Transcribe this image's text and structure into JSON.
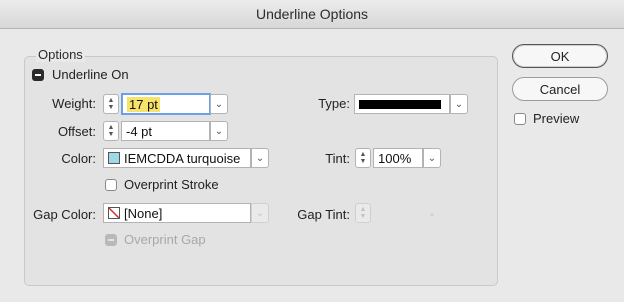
{
  "window": {
    "title": "Underline Options"
  },
  "options": {
    "group_label": "Options",
    "underline_on": {
      "label": "Underline On",
      "checked": true
    },
    "weight": {
      "label": "Weight:",
      "value": "17 pt"
    },
    "offset": {
      "label": "Offset:",
      "value": "-4 pt"
    },
    "type": {
      "label": "Type:"
    },
    "color": {
      "label": "Color:",
      "value": "IEMCDDA turquoise",
      "swatch": "#9fd8e8"
    },
    "tint": {
      "label": "Tint:",
      "value": "100%"
    },
    "overprint_stroke": {
      "label": "Overprint Stroke",
      "checked": false
    },
    "gap_color": {
      "label": "Gap Color:",
      "value": "[None]"
    },
    "gap_tint": {
      "label": "Gap Tint:",
      "value": ""
    },
    "overprint_gap": {
      "label": "Overprint Gap",
      "checked": true,
      "enabled": false
    }
  },
  "buttons": {
    "ok": "OK",
    "cancel": "Cancel"
  },
  "preview": {
    "label": "Preview",
    "checked": false
  },
  "colors": {
    "accent": "#6aa0e8",
    "highlight": "#f7e36b",
    "none_slash": "#d0282e"
  }
}
